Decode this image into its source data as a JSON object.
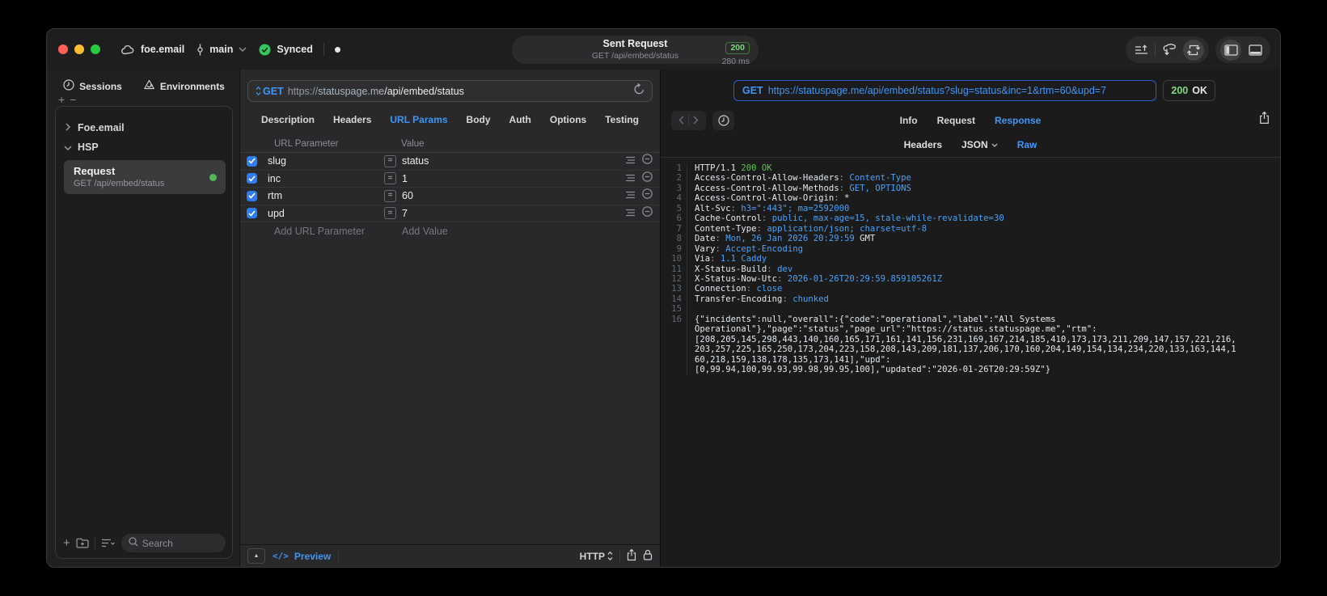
{
  "titlebar": {
    "project": "foe.email",
    "branch": "main",
    "sync_label": "Synced",
    "sent_request": {
      "title": "Sent Request",
      "subtitle": "GET /api/embed/status",
      "status_code": "200",
      "duration": "280 ms"
    }
  },
  "sidebar": {
    "tabs": [
      {
        "label": "Sessions"
      },
      {
        "label": "Environments"
      }
    ],
    "tree": [
      {
        "label": "Foe.email"
      },
      {
        "label": "HSP"
      }
    ],
    "request_item": {
      "title": "Request",
      "subtitle": "GET /api/embed/status"
    },
    "search_placeholder": "Search"
  },
  "request_pane": {
    "method_label": "GET",
    "url_scheme": "https://",
    "url_host": "statuspage.me",
    "url_path": "/api/embed/status",
    "tabs": [
      "Description",
      "Headers",
      "URL Params",
      "Body",
      "Auth",
      "Options",
      "Testing"
    ],
    "active_tab": "URL Params",
    "table": {
      "columns": [
        "URL Parameter",
        "Value"
      ],
      "rows": [
        {
          "name": "slug",
          "value": "status",
          "enabled": true
        },
        {
          "name": "inc",
          "value": "1",
          "enabled": true
        },
        {
          "name": "rtm",
          "value": "60",
          "enabled": true
        },
        {
          "name": "upd",
          "value": "7",
          "enabled": true
        }
      ],
      "add_name_placeholder": "Add URL Parameter",
      "add_value_placeholder": "Add Value"
    },
    "footer": {
      "code_glyph": "</>",
      "preview_label": "Preview",
      "protocol_label": "HTTP"
    }
  },
  "response_pane": {
    "request_line": {
      "method": "GET",
      "url": "https://statuspage.me/api/embed/status?slug=status&inc=1&rtm=60&upd=7"
    },
    "status": {
      "code": "200",
      "reason": "OK"
    },
    "tabs": [
      "Info",
      "Request",
      "Response"
    ],
    "active_tab": "Response",
    "subtabs": [
      "Headers",
      "JSON",
      "Raw"
    ],
    "active_subtab": "Raw",
    "lines": [
      {
        "n": "1",
        "parts": [
          {
            "t": "HTTP/1.1 ",
            "c": "p"
          },
          {
            "t": "200 OK",
            "c": "g"
          }
        ]
      },
      {
        "n": "2",
        "parts": [
          {
            "t": "Access-Control-Allow-Headers",
            "c": "p"
          },
          {
            "t": ": ",
            "c": "d"
          },
          {
            "t": "Content-Type",
            "c": "b"
          }
        ]
      },
      {
        "n": "3",
        "parts": [
          {
            "t": "Access-Control-Allow-Methods",
            "c": "p"
          },
          {
            "t": ": ",
            "c": "d"
          },
          {
            "t": "GET, OPTIONS",
            "c": "b"
          }
        ]
      },
      {
        "n": "4",
        "parts": [
          {
            "t": "Access-Control-Allow-Origin",
            "c": "p"
          },
          {
            "t": ": ",
            "c": "d"
          },
          {
            "t": "*",
            "c": "p"
          }
        ]
      },
      {
        "n": "5",
        "parts": [
          {
            "t": "Alt-Svc",
            "c": "p"
          },
          {
            "t": ": ",
            "c": "d"
          },
          {
            "t": "h3=\":443\"; ma=2592000",
            "c": "b"
          }
        ]
      },
      {
        "n": "6",
        "parts": [
          {
            "t": "Cache-Control",
            "c": "p"
          },
          {
            "t": ": ",
            "c": "d"
          },
          {
            "t": "public, max-age=15, stale-while-revalidate=30",
            "c": "b"
          }
        ]
      },
      {
        "n": "7",
        "parts": [
          {
            "t": "Content-Type",
            "c": "p"
          },
          {
            "t": ": ",
            "c": "d"
          },
          {
            "t": "application/json; charset=utf-8",
            "c": "b"
          }
        ]
      },
      {
        "n": "8",
        "parts": [
          {
            "t": "Date",
            "c": "p"
          },
          {
            "t": ": ",
            "c": "d"
          },
          {
            "t": "Mon, 26 Jan 2026 20:29:59",
            "c": "b"
          },
          {
            "t": " GMT",
            "c": "p"
          }
        ]
      },
      {
        "n": "9",
        "parts": [
          {
            "t": "Vary",
            "c": "p"
          },
          {
            "t": ": ",
            "c": "d"
          },
          {
            "t": "Accept-Encoding",
            "c": "b"
          }
        ]
      },
      {
        "n": "10",
        "parts": [
          {
            "t": "Via",
            "c": "p"
          },
          {
            "t": ": ",
            "c": "d"
          },
          {
            "t": "1.1 Caddy",
            "c": "b"
          }
        ]
      },
      {
        "n": "11",
        "parts": [
          {
            "t": "X-Status-Build",
            "c": "p"
          },
          {
            "t": ": ",
            "c": "d"
          },
          {
            "t": "dev",
            "c": "b"
          }
        ]
      },
      {
        "n": "12",
        "parts": [
          {
            "t": "X-Status-Now-Utc",
            "c": "p"
          },
          {
            "t": ": ",
            "c": "d"
          },
          {
            "t": "2026-01-26T20:29:59.859105261Z",
            "c": "b"
          }
        ]
      },
      {
        "n": "13",
        "parts": [
          {
            "t": "Connection",
            "c": "p"
          },
          {
            "t": ": ",
            "c": "d"
          },
          {
            "t": "close",
            "c": "b"
          }
        ]
      },
      {
        "n": "14",
        "parts": [
          {
            "t": "Transfer-Encoding",
            "c": "p"
          },
          {
            "t": ": ",
            "c": "d"
          },
          {
            "t": "chunked",
            "c": "b"
          }
        ]
      },
      {
        "n": "15",
        "parts": []
      },
      {
        "n": "16",
        "parts": [
          {
            "t": "{\"incidents\":null,\"overall\":{\"code\":\"operational\",\"label\":\"All Systems",
            "c": "p"
          }
        ]
      },
      {
        "n": "",
        "parts": [
          {
            "t": "Operational\"},\"page\":\"status\",\"page_url\":\"https://status.statuspage.me\",\"rtm\":",
            "c": "p"
          }
        ]
      },
      {
        "n": "",
        "parts": [
          {
            "t": "[208,205,145,298,443,140,160,165,171,161,141,156,231,169,167,214,185,410,173,173,211,209,147,157,221,216,",
            "c": "p"
          }
        ]
      },
      {
        "n": "",
        "parts": [
          {
            "t": "203,257,225,165,250,173,204,223,158,208,143,209,181,137,206,170,160,204,149,154,134,234,220,133,163,144,1",
            "c": "p"
          }
        ]
      },
      {
        "n": "",
        "parts": [
          {
            "t": "60,218,159,138,178,135,173,141],\"upd\":",
            "c": "p"
          }
        ]
      },
      {
        "n": "",
        "parts": [
          {
            "t": "[0,99.94,100,99.93,99.98,99.95,100],\"updated\":\"2026-01-26T20:29:59Z\"}",
            "c": "p"
          }
        ]
      }
    ]
  },
  "colors": {
    "accent_blue": "#3e96f6",
    "checkbox_blue": "#2e7cf6",
    "status_green_badge": "#7ed87d",
    "sync_green": "#34c759",
    "response_green": "#5bc749",
    "response_blue": "#4aa2f8",
    "traffic_red": "#ff5f57",
    "traffic_yellow": "#febc2e",
    "traffic_green": "#28c840"
  }
}
